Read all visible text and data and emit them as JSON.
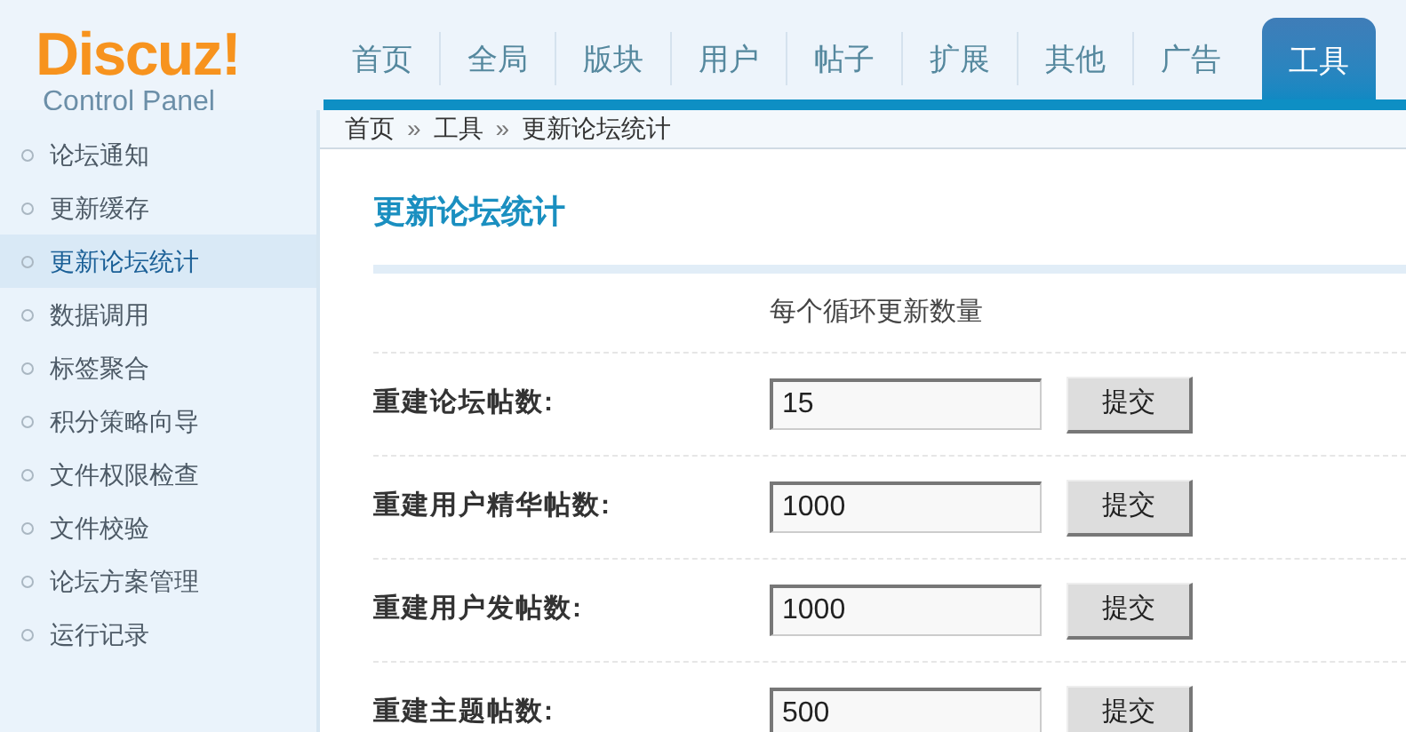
{
  "logo": {
    "name": "Discuz!",
    "subtitle": "Control Panel"
  },
  "nav_tabs": [
    {
      "label": "首页",
      "selected": false
    },
    {
      "label": "全局",
      "selected": false
    },
    {
      "label": "版块",
      "selected": false
    },
    {
      "label": "用户",
      "selected": false
    },
    {
      "label": "帖子",
      "selected": false
    },
    {
      "label": "扩展",
      "selected": false
    },
    {
      "label": "其他",
      "selected": false
    },
    {
      "label": "广告",
      "selected": false
    },
    {
      "label": "工具",
      "selected": true
    }
  ],
  "breadcrumb": {
    "items": [
      "首页",
      "工具",
      "更新论坛统计"
    ],
    "separator": "»"
  },
  "sidebar": {
    "items": [
      {
        "label": "论坛通知",
        "selected": false
      },
      {
        "label": "更新缓存",
        "selected": false
      },
      {
        "label": "更新论坛统计",
        "selected": true
      },
      {
        "label": "数据调用",
        "selected": false
      },
      {
        "label": "标签聚合",
        "selected": false
      },
      {
        "label": "积分策略向导",
        "selected": false
      },
      {
        "label": "文件权限检查",
        "selected": false
      },
      {
        "label": "文件校验",
        "selected": false
      },
      {
        "label": "论坛方案管理",
        "selected": false
      },
      {
        "label": "运行记录",
        "selected": false
      }
    ]
  },
  "content": {
    "title": "更新论坛统计",
    "column_header": "每个循环更新数量",
    "rows": [
      {
        "label": "重建论坛帖数:",
        "value": "15",
        "button": "提交"
      },
      {
        "label": "重建用户精华帖数:",
        "value": "1000",
        "button": "提交"
      },
      {
        "label": "重建用户发帖数:",
        "value": "1000",
        "button": "提交"
      },
      {
        "label": "重建主题帖数:",
        "value": "500",
        "button": "提交"
      }
    ]
  }
}
